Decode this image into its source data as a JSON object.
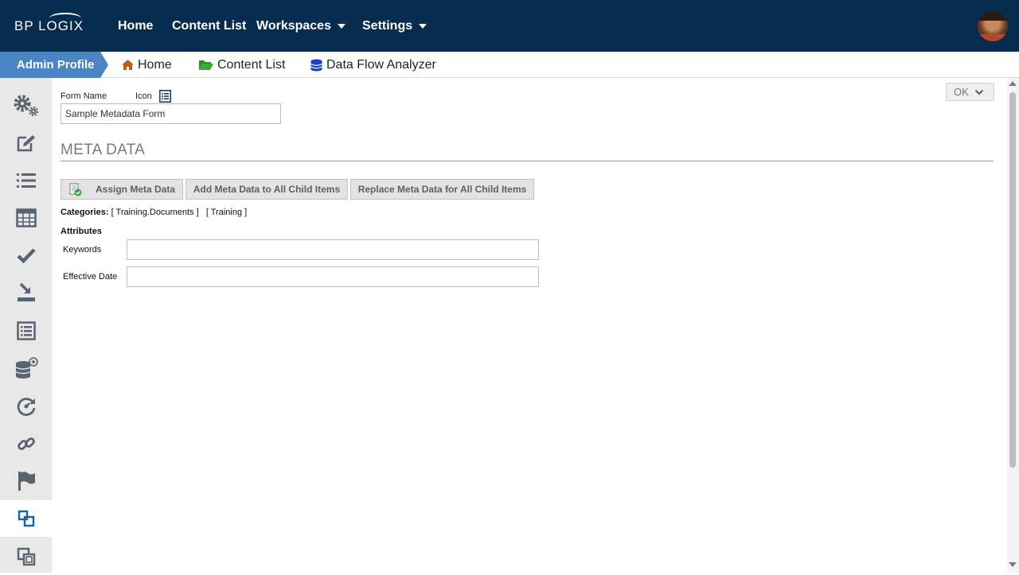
{
  "topnav": {
    "logo": "BP LOGIX",
    "items": [
      {
        "label": "Home"
      },
      {
        "label": "Content List"
      },
      {
        "label": "Workspaces"
      },
      {
        "label": "Settings"
      }
    ]
  },
  "breadcrumb": {
    "active": "Admin Profile",
    "items": [
      {
        "label": "Home",
        "icon": "home-icon",
        "color": "#c55a11"
      },
      {
        "label": "Content List",
        "icon": "folder-open-icon",
        "color": "#2e8b2e"
      },
      {
        "label": "Data Flow Analyzer",
        "icon": "database-icon",
        "color": "#1e3fbf"
      }
    ]
  },
  "sidebar": {
    "items": [
      {
        "icon": "gears-icon"
      },
      {
        "icon": "edit-icon"
      },
      {
        "icon": "list-icon"
      },
      {
        "icon": "table-icon"
      },
      {
        "icon": "check-icon"
      },
      {
        "icon": "download-tray-icon"
      },
      {
        "icon": "list-alt-icon"
      },
      {
        "icon": "database-plus-icon"
      },
      {
        "icon": "dashboard-refresh-icon"
      },
      {
        "icon": "link-icon"
      },
      {
        "icon": "flag-icon"
      },
      {
        "icon": "clone-icon",
        "active": true
      },
      {
        "icon": "clone-alt-icon"
      }
    ]
  },
  "form": {
    "form_name_label": "Form Name",
    "icon_label": "Icon",
    "form_name_value": "Sample Metadata Form",
    "section_title": "META DATA",
    "buttons": {
      "assign": "Assign Meta Data",
      "add_all": "Add Meta Data to All Child Items",
      "replace_all": "Replace Meta Data for All Child Items"
    },
    "categories_label": "Categories:",
    "categories": [
      "[ Training.Documents ]",
      "[ Training ]"
    ],
    "attributes_title": "Attributes",
    "attributes": [
      {
        "label": "Keywords",
        "value": ""
      },
      {
        "label": "Effective Date",
        "value": ""
      }
    ],
    "ok_label": "OK"
  },
  "colors": {
    "topbar": "#062c4f",
    "breadcrumb_active": "#4b84c4",
    "sidebar_bg": "#e8e8e8",
    "accent_blue": "#1565a8"
  }
}
